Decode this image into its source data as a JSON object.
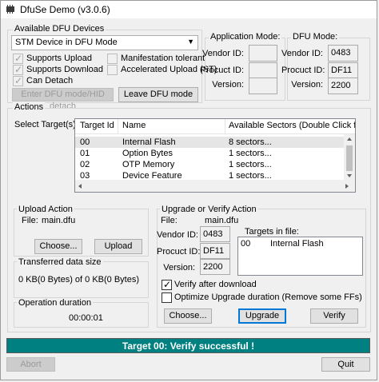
{
  "window": {
    "title": "DfuSe Demo (v3.0.6)"
  },
  "available_devices": {
    "group_label": "Available DFU Devices",
    "device_selected": "STM Device in DFU Mode",
    "checkboxes": [
      {
        "label": "Supports Upload",
        "checked": true
      },
      {
        "label": "Supports Download",
        "checked": true
      },
      {
        "label": "Can Detach",
        "checked": true
      },
      {
        "label": "Manifestation tolerant",
        "checked": false
      },
      {
        "label": "Accelerated Upload (ST)",
        "checked": false
      }
    ],
    "enter_dfu_button": "Enter DFU mode/HID detach",
    "leave_dfu_button": "Leave DFU mode"
  },
  "application_mode": {
    "group_label": "Application Mode:",
    "vendor_label": "Vendor ID:",
    "vendor_value": "",
    "product_label": "Procuct ID:",
    "product_value": "",
    "version_label": "Version:",
    "version_value": ""
  },
  "dfu_mode": {
    "group_label": "DFU Mode:",
    "vendor_label": "Vendor ID:",
    "vendor_value": "0483",
    "product_label": "Procuct ID:",
    "product_value": "DF11",
    "version_label": "Version:",
    "version_value": "2200"
  },
  "actions": {
    "group_label": "Actions",
    "select_targets_label": "Select Target(s):",
    "columns": [
      "Target Id",
      "Name",
      "Available Sectors (Double Click for more)"
    ],
    "rows": [
      {
        "id": "00",
        "name": "Internal Flash",
        "sectors": "8 sectors..."
      },
      {
        "id": "01",
        "name": "Option Bytes",
        "sectors": "1 sectors..."
      },
      {
        "id": "02",
        "name": "OTP Memory",
        "sectors": "1 sectors..."
      },
      {
        "id": "03",
        "name": "Device Feature",
        "sectors": "1 sectors..."
      }
    ]
  },
  "upload_action": {
    "group_label": "Upload Action",
    "file_label": "File:",
    "file_value": "main.dfu",
    "choose_button": "Choose...",
    "upload_button": "Upload"
  },
  "transferred": {
    "group_label": "Transferred data size",
    "value": "0 KB(0 Bytes) of 0 KB(0 Bytes)"
  },
  "operation_duration": {
    "group_label": "Operation duration",
    "value": "00:00:01"
  },
  "upgrade_verify": {
    "group_label": "Upgrade or Verify Action",
    "file_label": "File:",
    "file_value": "main.dfu",
    "vendor_label": "Vendor ID:",
    "vendor_value": "0483",
    "product_label": "Procuct ID:",
    "product_value": "DF11",
    "version_label": "Version:",
    "version_value": "2200",
    "targets_in_file_label": "Targets in file:",
    "targets_in_file": [
      {
        "id": "00",
        "name": "Internal Flash"
      }
    ],
    "verify_after_download": {
      "label": "Verify after download",
      "checked": true
    },
    "optimize": {
      "label": "Optimize Upgrade duration (Remove some FFs)",
      "checked": false
    },
    "choose_button": "Choose...",
    "upgrade_button": "Upgrade",
    "verify_button": "Verify"
  },
  "status_message": "Target 00: Verify successful !",
  "abort_button": "Abort",
  "quit_button": "Quit",
  "colors": {
    "status_bg": "#008080",
    "accent_focus": "#0078d7"
  }
}
